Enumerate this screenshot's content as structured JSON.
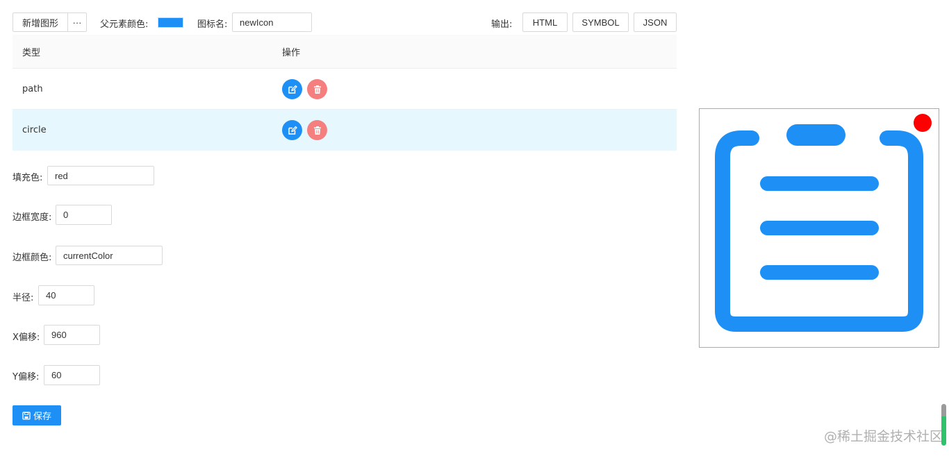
{
  "toolbar": {
    "add_shape_label": "新增图形",
    "more_label": "···",
    "parent_color_label": "父元素颜色:",
    "parent_color_value": "#1e90f5",
    "icon_name_label": "图标名:",
    "icon_name_value": "newIcon",
    "output_label": "输出:",
    "output_buttons": [
      "HTML",
      "SYMBOL",
      "JSON"
    ]
  },
  "table": {
    "headers": [
      "类型",
      "操作"
    ],
    "rows": [
      {
        "type": "path"
      },
      {
        "type": "circle"
      }
    ]
  },
  "form": {
    "fill_label": "填充色:",
    "fill_value": "red",
    "stroke_width_label": "边框宽度:",
    "stroke_width_value": "0",
    "stroke_color_label": "边框颜色:",
    "stroke_color_value": "currentColor",
    "radius_label": "半径:",
    "radius_value": "40",
    "x_offset_label": "X偏移:",
    "x_offset_value": "960",
    "y_offset_label": "Y偏移:",
    "y_offset_value": "60",
    "save_label": "保存"
  },
  "icons": {
    "edit": "edit-icon",
    "delete": "trash-icon",
    "save": "save-icon"
  },
  "colors": {
    "primary": "#1e90f5",
    "danger": "#f57f7f",
    "circle_fill": "#ff0000"
  },
  "watermark": "@稀土掘金技术社区"
}
